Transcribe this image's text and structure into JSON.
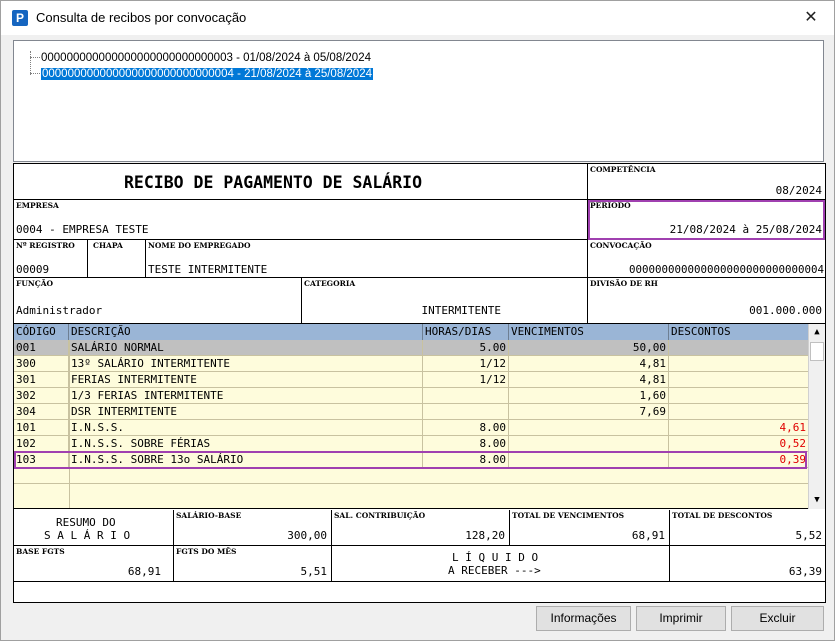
{
  "window": {
    "title": "Consulta de recibos por convocação",
    "icon_letter": "P",
    "close_glyph": "✕"
  },
  "tree": {
    "items": [
      {
        "label": "000000000000000000000000000003 - 01/08/2024 à 05/08/2024",
        "selected": false
      },
      {
        "label": "000000000000000000000000000004 - 21/08/2024 à 25/08/2024",
        "selected": true
      }
    ]
  },
  "receipt": {
    "title": "RECIBO DE PAGAMENTO DE SALÁRIO",
    "competencia_label": "COMPETÊNCIA",
    "competencia": "08/2024",
    "empresa_label": "EMPRESA",
    "empresa": "0004 - EMPRESA TESTE",
    "periodo_label": "PERÍODO",
    "periodo": "21/08/2024 à 25/08/2024",
    "registro_label": "Nº REGISTRO",
    "registro": "00009",
    "chapa_label": "CHAPA",
    "chapa": "",
    "nome_label": "NOME DO EMPREGADO",
    "nome": "TESTE INTERMITENTE",
    "convocacao_label": "CONVOCAÇÃO",
    "convocacao": "000000000000000000000000000004",
    "funcao_label": "FUNÇÃO",
    "funcao": "Administrador",
    "categoria_label": "CATEGORIA",
    "categoria": "INTERMITENTE",
    "divisao_label": "DIVISÃO DE RH",
    "divisao": "001.000.000"
  },
  "grid": {
    "headers": [
      "CÓDIGO",
      "DESCRIÇÃO",
      "HORAS/DIAS",
      "VENCIMENTOS",
      "DESCONTOS"
    ],
    "rows": [
      {
        "codigo": "001",
        "descricao": "SALÁRIO NORMAL",
        "horas": "5.00",
        "venc": "50,00",
        "desc": ""
      },
      {
        "codigo": "300",
        "descricao": "13º SALÁRIO INTERMITENTE",
        "horas": "1/12",
        "venc": "4,81",
        "desc": ""
      },
      {
        "codigo": "301",
        "descricao": "FERIAS INTERMITENTE",
        "horas": "1/12",
        "venc": "4,81",
        "desc": ""
      },
      {
        "codigo": "302",
        "descricao": "1/3 FERIAS INTERMITENTE",
        "horas": "",
        "venc": "1,60",
        "desc": ""
      },
      {
        "codigo": "304",
        "descricao": "DSR INTERMITENTE",
        "horas": "",
        "venc": "7,69",
        "desc": ""
      },
      {
        "codigo": "101",
        "descricao": "I.N.S.S.",
        "horas": "8.00",
        "venc": "",
        "desc": "4,61"
      },
      {
        "codigo": "102",
        "descricao": "I.N.S.S. SOBRE FÉRIAS",
        "horas": "8.00",
        "venc": "",
        "desc": "0,52"
      },
      {
        "codigo": "103",
        "descricao": "I.N.S.S. SOBRE 13o SALÁRIO",
        "horas": "8.00",
        "venc": "",
        "desc": "0,39"
      }
    ],
    "scroll_up": "▲",
    "scroll_down": "▼"
  },
  "summary": {
    "resumo_line1": "RESUMO DO",
    "resumo_line2": "S A L Á R I O",
    "salario_base_label": "SALÁRIO-BASE",
    "salario_base": "300,00",
    "sal_contribuicao_label": "SAL. CONTRIBUIÇÃO",
    "sal_contribuicao": "128,20",
    "total_venc_label": "TOTAL DE VENCIMENTOS",
    "total_venc": "68,91",
    "total_desc_label": "TOTAL DE DESCONTOS",
    "total_desc": "5,52",
    "base_fgts_label": "BASE FGTS",
    "base_fgts": "68,91",
    "fgts_mes_label": "FGTS DO MÊS",
    "fgts_mes": "5,51",
    "liquido_line1": "L Í Q U I D O",
    "liquido_line2": "A RECEBER --->",
    "liquido": "63,39"
  },
  "buttons": {
    "informacoes": "Informações",
    "imprimir": "Imprimir",
    "excluir": "Excluir"
  },
  "colors": {
    "selection": "#0078d7",
    "grid_header": "#9ab5d6",
    "grid_background": "#fefcdc",
    "discount_text": "#e00000",
    "highlight": "#a040b0"
  }
}
